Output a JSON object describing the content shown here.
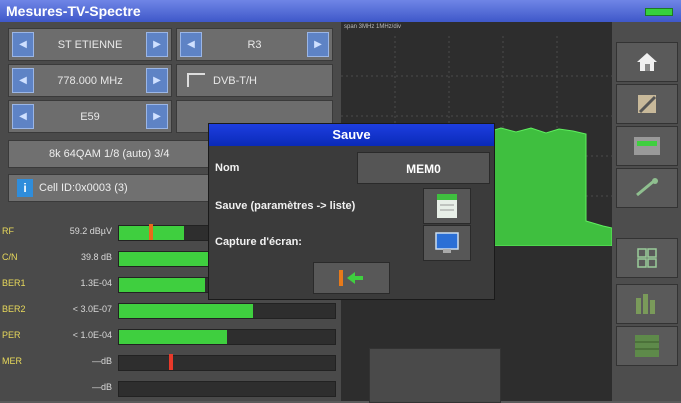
{
  "app": {
    "title": "Mesures-TV-Spectre"
  },
  "left": {
    "rows": [
      {
        "left_label": "ST ETIENNE",
        "right_label": "R3"
      },
      {
        "left_label": "778.000 MHz",
        "right_label": "DVB-T/H"
      },
      {
        "left_label": "E59",
        "right_label": ""
      }
    ],
    "modulation": "8k 64QAM 1/8 (auto) 3/4",
    "cell_id": "Cell ID:0x0003 (3)",
    "measurements": [
      {
        "name": "RF",
        "value": "59.2 dBµV",
        "fill": 0.3
      },
      {
        "name": "C/N",
        "value": "39.8 dB",
        "fill": 0.45
      },
      {
        "name": "BER1",
        "value": "1.3E-04",
        "fill": 0.4
      },
      {
        "name": "BER2",
        "value": "< 3.0E-07",
        "fill": 0.62
      },
      {
        "name": "PER",
        "value": "< 1.0E-04",
        "fill": 0.5
      },
      {
        "name": "MER",
        "value": "—dB",
        "fill": 0.0
      },
      {
        "name": "",
        "value": "—dB",
        "fill": 0.0
      }
    ]
  },
  "spectrum": {
    "header": "span 3MHz 1MHz/div"
  },
  "dialog": {
    "title": "Sauve",
    "name_label": "Nom",
    "name_value": "MEM0",
    "save_params_label": "Sauve (paramètres -> liste)",
    "capture_label": "Capture d'écran:"
  },
  "colors": {
    "accent": "#1d3ee0",
    "bar": "#3fcf3f",
    "titlebar": "#4f67d6"
  }
}
